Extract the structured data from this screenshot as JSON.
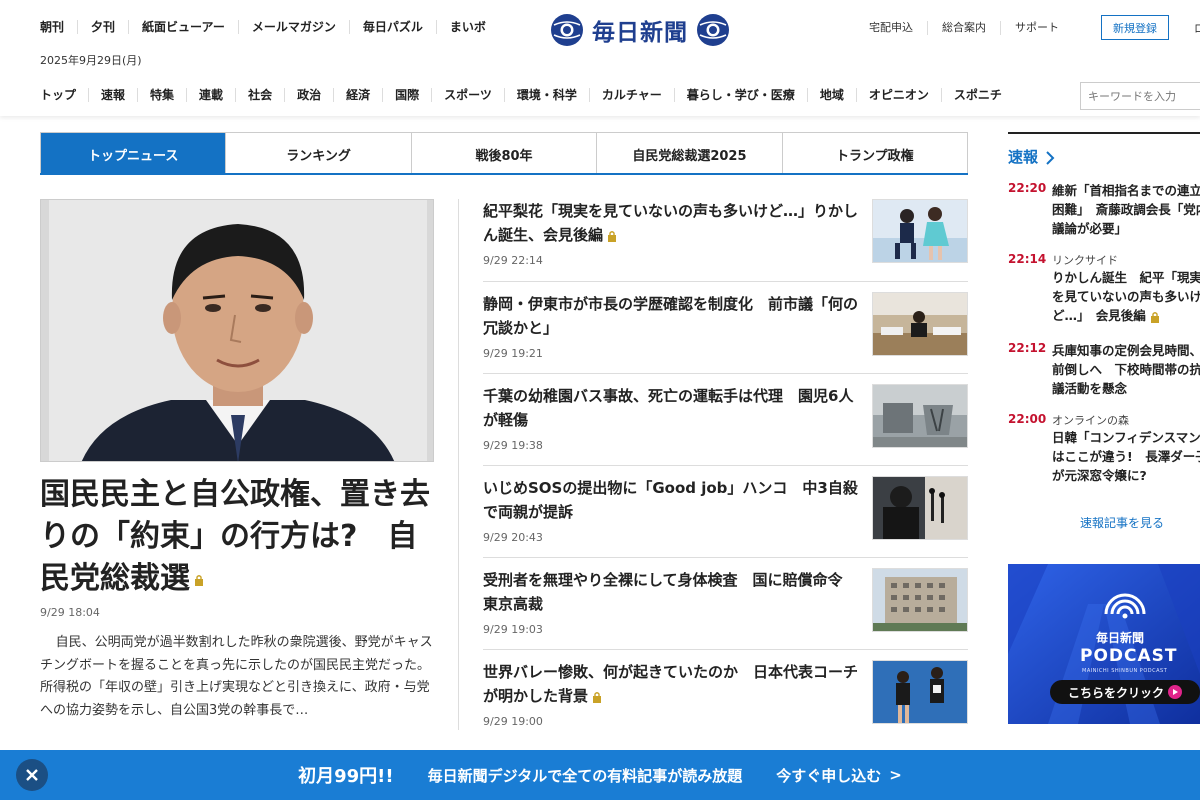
{
  "header": {
    "top_links": [
      "朝刊",
      "夕刊",
      "紙面ビューアー",
      "メールマガジン",
      "毎日パズル",
      "まいボ"
    ],
    "date": "2025年9月29日(月)",
    "logo_text": "毎日新聞",
    "right_links": [
      "宅配申込",
      "総合案内",
      "サポート"
    ],
    "register_label": "新規登録",
    "cut_label": "ロ",
    "nav": [
      "トップ",
      "速報",
      "特集",
      "連載",
      "社会",
      "政治",
      "経済",
      "国際",
      "スポーツ",
      "環境・科学",
      "カルチャー",
      "暮らし・学び・医療",
      "地域",
      "オピニオン",
      "スポニチ"
    ],
    "search_placeholder": "キーワードを入力"
  },
  "tabs": [
    "トップニュース",
    "ランキング",
    "戦後80年",
    "自民党総裁選2025",
    "トランプ政権"
  ],
  "main_article": {
    "title": "国民民主と自公政権、置き去りの「約束」の行方は?　自民党総裁選",
    "date": "9/29 18:04",
    "summary": "自民、公明両党が過半数割れした昨秋の衆院選後、野党がキャスチングボートを握ることを真っ先に示したのが国民民主党だった。所得税の「年収の壁」引き上げ実現などと引き換えに、政府・与党への協力姿勢を示し、自公国3党の幹事長で…",
    "locked": true
  },
  "news": [
    {
      "title": "紀平梨花「現実を見ていないの声も多いけど…」りかしん誕生、会見後編",
      "date": "9/29 22:14",
      "locked": true,
      "thumb": "skaters"
    },
    {
      "title": "静岡・伊東市が市長の学歴確認を制度化　前市議「何の冗談かと」",
      "date": "9/29 19:21",
      "locked": false,
      "thumb": "council"
    },
    {
      "title": "千葉の幼稚園バス事故、死亡の運転手は代理　園児6人が軽傷",
      "date": "9/29 19:38",
      "locked": false,
      "thumb": "accident"
    },
    {
      "title": "いじめSOSの提出物に「Good job」ハンコ　中3自殺で両親が提訴",
      "date": "9/29 20:43",
      "locked": false,
      "thumb": "press"
    },
    {
      "title": "受刑者を無理やり全裸にして身体検査　国に賠償命令　東京高裁",
      "date": "9/29 19:03",
      "locked": false,
      "thumb": "building"
    },
    {
      "title": "世界バレー惨敗、何が起きていたのか　日本代表コーチが明かした背景",
      "date": "9/29 19:00",
      "locked": true,
      "thumb": "volleyball"
    }
  ],
  "sidebar": {
    "heading": "速報",
    "items": [
      {
        "time": "22:20",
        "sub": "",
        "title": "維新「首相指名までの連立困難」　斎藤政調会長「党内議論が必要」",
        "locked": false
      },
      {
        "time": "22:14",
        "sub": "リンクサイド",
        "title": "りかしん誕生　紀平「現実を見ていないの声も多いけど…」　会見後編",
        "locked": true
      },
      {
        "time": "22:12",
        "sub": "",
        "title": "兵庫知事の定例会見時間、前倒しへ　下校時間帯の抗議活動を懸念",
        "locked": false
      },
      {
        "time": "22:00",
        "sub": "オンラインの森",
        "title": "日韓「コンフィデンスマン」はここが違う!　長澤ダー子が元深窓令嬢に?",
        "locked": false
      }
    ],
    "more_link": "速報記事を見る",
    "podcast": {
      "brand": "毎日新聞",
      "title": "PODCAST",
      "sub": "MAINICHI SHINBUN PODCAST",
      "button": "こちらをクリック"
    }
  },
  "banner": {
    "price": "初月99円!!",
    "message": "毎日新聞デジタルで全ての有料記事が読み放題",
    "cta": "今すぐ申し込む",
    "cta_arrow": ">"
  },
  "colors": {
    "accent": "#1472c4",
    "brand": "#1f3f8f",
    "time_red": "#c4122f",
    "banner": "#1a7dd4"
  }
}
